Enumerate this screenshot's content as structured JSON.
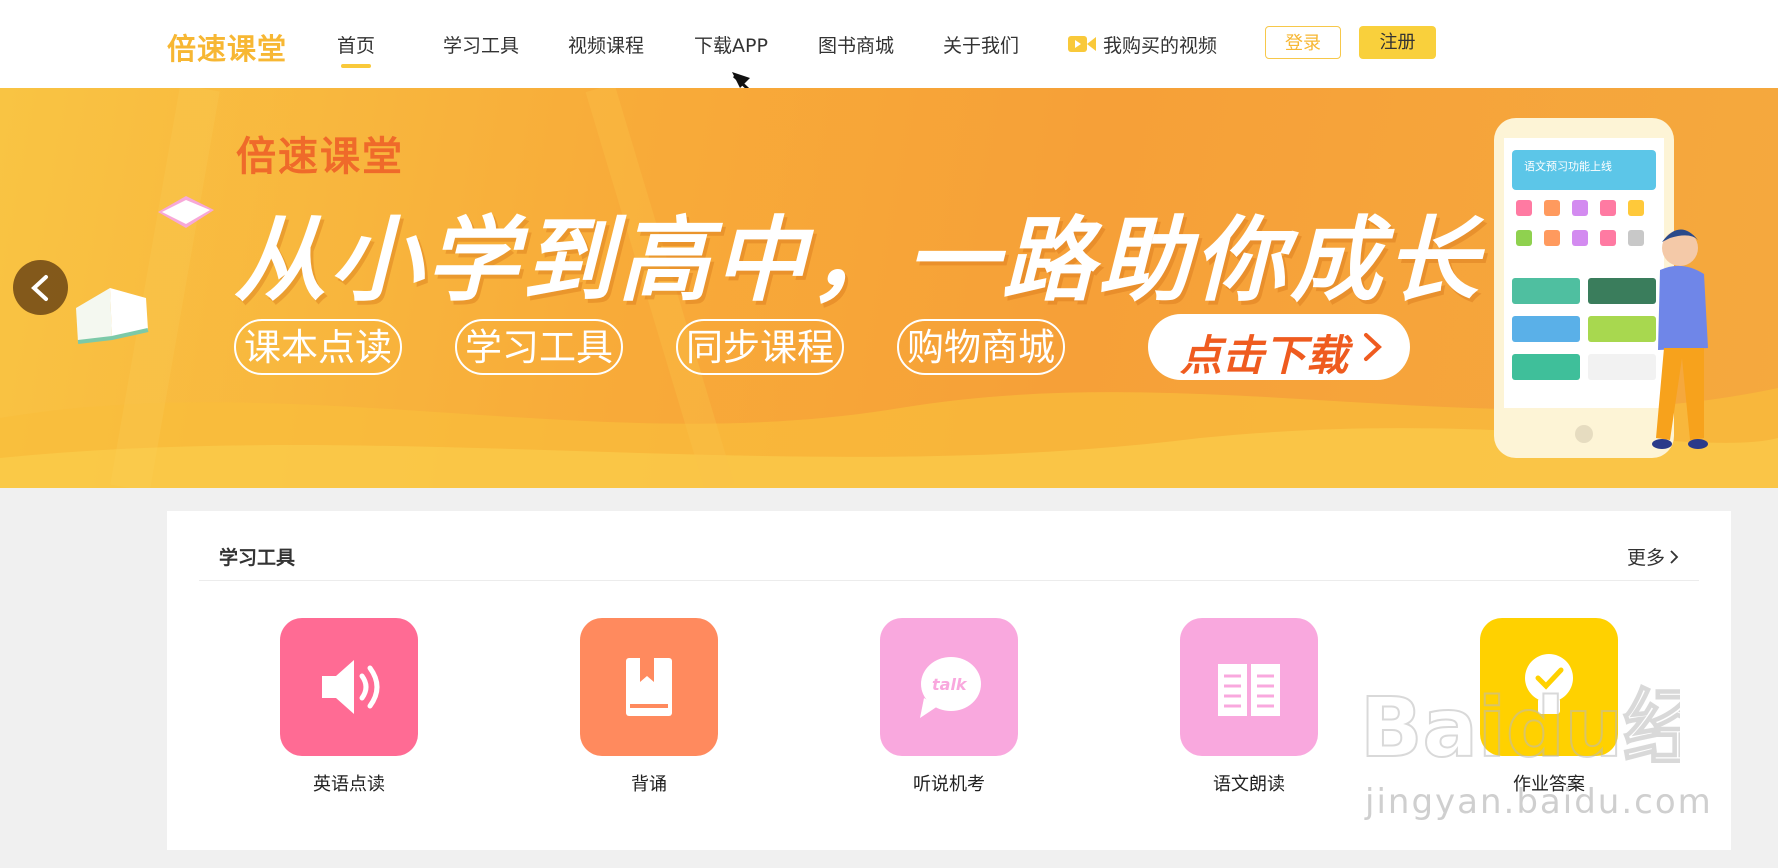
{
  "header": {
    "logo": "倍速课堂",
    "nav": [
      {
        "label": "首页"
      },
      {
        "label": "学习工具"
      },
      {
        "label": "视频课程"
      },
      {
        "label": "下载APP"
      },
      {
        "label": "图书商城"
      },
      {
        "label": "关于我们"
      },
      {
        "label": "我购买的视频"
      }
    ],
    "active_nav": "首页",
    "login_label": "登录",
    "register_label": "注册"
  },
  "banner": {
    "brand": "倍速课堂",
    "headline": "从小学到高中，一路助你成长",
    "pills": [
      "课本点读",
      "学习工具",
      "同步课程",
      "购物商城"
    ],
    "cta_label": "点击下载",
    "phone_banner_text": "语文预习功能上线"
  },
  "section": {
    "title": "学习工具",
    "more_label": "更多",
    "tools": [
      {
        "label": "英语点读",
        "icon": "speaker-icon",
        "color": "#ff6b94"
      },
      {
        "label": "背诵",
        "icon": "book-icon",
        "color": "#ff8a5e"
      },
      {
        "label": "听说机考",
        "icon": "talk-bubble-icon",
        "color": "#f9a8de"
      },
      {
        "label": "语文朗读",
        "icon": "open-book-icon",
        "color": "#f9a8de"
      },
      {
        "label": "作业答案",
        "icon": "lightbulb-check-icon",
        "color": "#ffd100"
      }
    ]
  },
  "watermark": {
    "text": "jingyan.baidu.com",
    "logo": "Baidu经验"
  },
  "colors": {
    "accent": "#f9d03c",
    "banner": "#f7a63a",
    "cta_text": "#ef5b1f"
  }
}
